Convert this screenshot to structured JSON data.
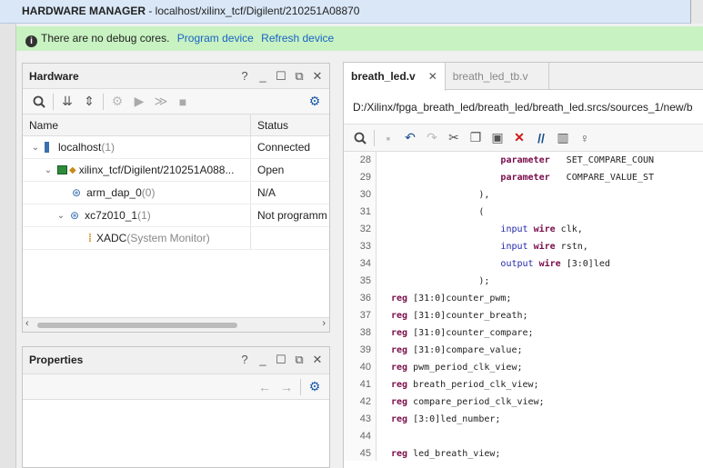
{
  "title": {
    "bold": "HARDWARE MANAGER",
    "rest": " - localhost/xilinx_tcf/Digilent/210251A08870"
  },
  "banner": {
    "message": "There are no debug cores.",
    "program": "Program device",
    "refresh": "Refresh device"
  },
  "hardware": {
    "title": "Hardware",
    "col_name": "Name",
    "col_status": "Status",
    "rows": [
      {
        "name": "localhost",
        "count": " (1)",
        "status": "Connected"
      },
      {
        "name": "xilinx_tcf/Digilent/210251A088...",
        "count": "",
        "status": "Open"
      },
      {
        "name": "arm_dap_0",
        "count": " (0)",
        "status": "N/A"
      },
      {
        "name": "xc7z010_1",
        "count": " (1)",
        "status": "Not programm"
      },
      {
        "name": "XADC",
        "count": " (System Monitor)",
        "status": ""
      }
    ]
  },
  "properties": {
    "title": "Properties"
  },
  "editor": {
    "tabs": [
      "breath_led.v",
      "breath_led_tb.v"
    ],
    "path": "D:/Xilinx/fpga_breath_led/breath_led/breath_led.srcs/sources_1/new/b",
    "lines": [
      {
        "n": "28",
        "parts": [
          {
            "t": "                    "
          },
          {
            "t": "parameter",
            "c": "kw"
          },
          {
            "t": "   SET_COMPARE_COUN"
          }
        ]
      },
      {
        "n": "29",
        "parts": [
          {
            "t": "                    "
          },
          {
            "t": "parameter",
            "c": "kw"
          },
          {
            "t": "   COMPARE_VALUE_ST"
          }
        ]
      },
      {
        "n": "30",
        "parts": [
          {
            "t": "                ),"
          }
        ]
      },
      {
        "n": "31",
        "parts": [
          {
            "t": "                ("
          }
        ]
      },
      {
        "n": "32",
        "parts": [
          {
            "t": "                    "
          },
          {
            "t": "input",
            "c": "kb"
          },
          {
            "t": " "
          },
          {
            "t": "wire",
            "c": "kw"
          },
          {
            "t": " clk,"
          }
        ]
      },
      {
        "n": "33",
        "parts": [
          {
            "t": "                    "
          },
          {
            "t": "input",
            "c": "kb"
          },
          {
            "t": " "
          },
          {
            "t": "wire",
            "c": "kw"
          },
          {
            "t": " rstn,"
          }
        ]
      },
      {
        "n": "34",
        "parts": [
          {
            "t": "                    "
          },
          {
            "t": "output",
            "c": "kb"
          },
          {
            "t": " "
          },
          {
            "t": "wire",
            "c": "kw"
          },
          {
            "t": " [3:0]led"
          }
        ]
      },
      {
        "n": "35",
        "parts": [
          {
            "t": "                );"
          }
        ]
      },
      {
        "n": "36",
        "parts": [
          {
            "t": "reg",
            "c": "kw"
          },
          {
            "t": " [31:0]counter_pwm;"
          }
        ]
      },
      {
        "n": "37",
        "parts": [
          {
            "t": "reg",
            "c": "kw"
          },
          {
            "t": " [31:0]counter_breath;"
          }
        ]
      },
      {
        "n": "38",
        "parts": [
          {
            "t": "reg",
            "c": "kw"
          },
          {
            "t": " [31:0]counter_compare;"
          }
        ]
      },
      {
        "n": "39",
        "parts": [
          {
            "t": "reg",
            "c": "kw"
          },
          {
            "t": " [31:0]compare_value;"
          }
        ]
      },
      {
        "n": "40",
        "parts": [
          {
            "t": "reg",
            "c": "kw"
          },
          {
            "t": " pwm_period_clk_view;"
          }
        ]
      },
      {
        "n": "41",
        "parts": [
          {
            "t": "reg",
            "c": "kw"
          },
          {
            "t": " breath_period_clk_view;"
          }
        ]
      },
      {
        "n": "42",
        "parts": [
          {
            "t": "reg",
            "c": "kw"
          },
          {
            "t": " compare_period_clk_view;"
          }
        ]
      },
      {
        "n": "43",
        "parts": [
          {
            "t": "reg",
            "c": "kw"
          },
          {
            "t": " [3:0]led_number;"
          }
        ]
      },
      {
        "n": "44",
        "parts": [
          {
            "t": ""
          }
        ]
      },
      {
        "n": "45",
        "parts": [
          {
            "t": "reg",
            "c": "kw"
          },
          {
            "t": " led_breath_view;"
          }
        ]
      }
    ]
  }
}
